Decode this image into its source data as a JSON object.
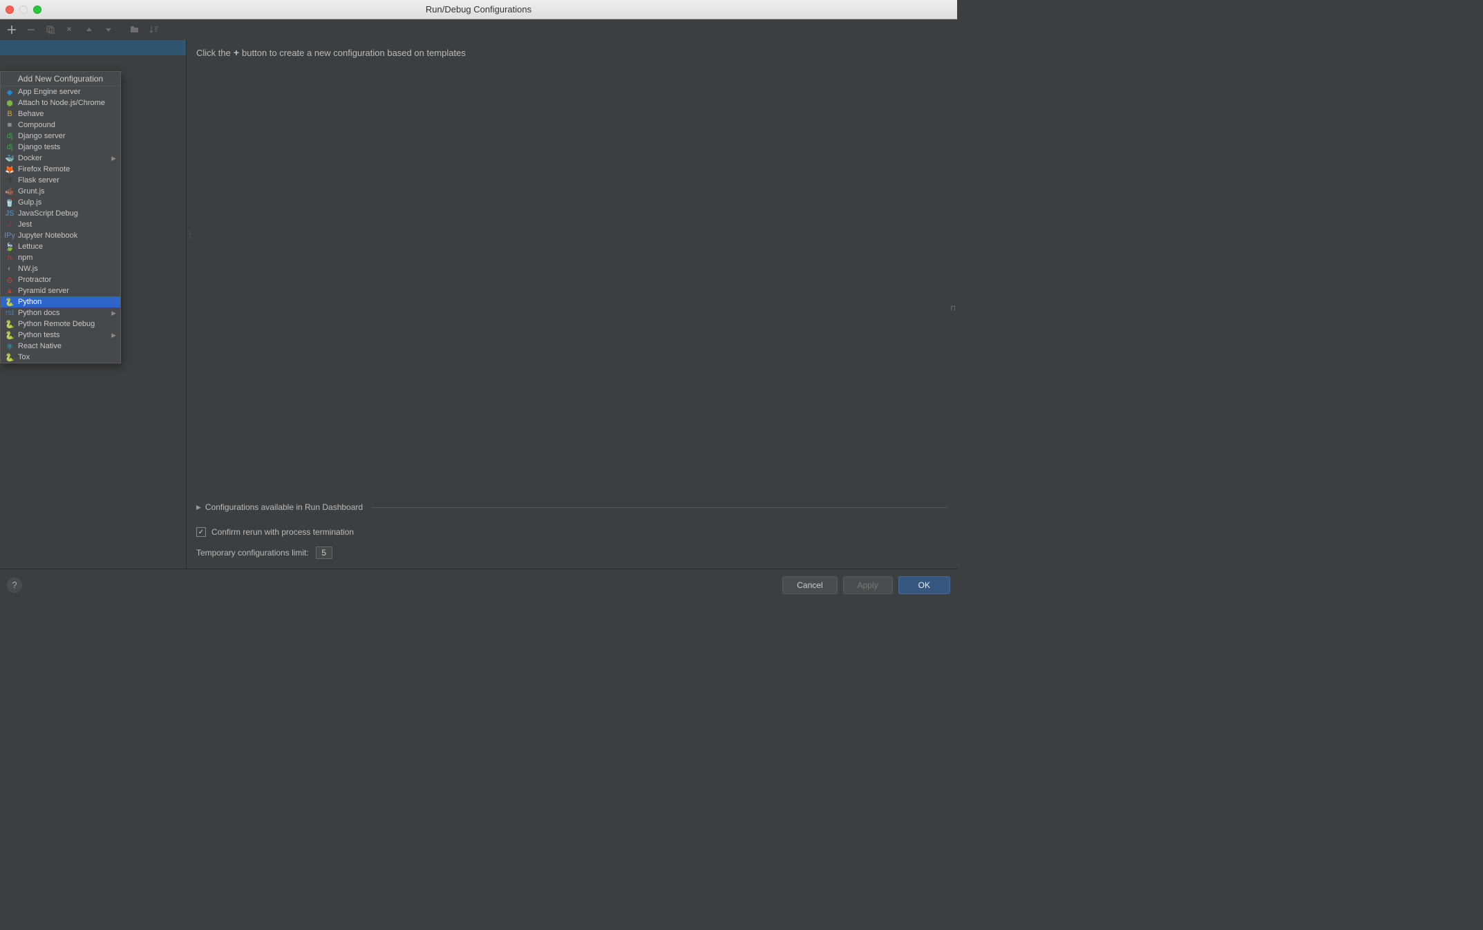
{
  "title": "Run/Debug Configurations",
  "dropdown": {
    "title": "Add New Configuration",
    "items": [
      {
        "label": "App Engine server",
        "icon": "◆",
        "color": "#1f8bd6"
      },
      {
        "label": "Attach to Node.js/Chrome",
        "icon": "⬢",
        "color": "#7cb342"
      },
      {
        "label": "Behave",
        "icon": "B",
        "color": "#d8a03c"
      },
      {
        "label": "Compound",
        "icon": "■",
        "color": "#8a8d8f"
      },
      {
        "label": "Django server",
        "icon": "dj",
        "color": "#43a047"
      },
      {
        "label": "Django tests",
        "icon": "dj",
        "color": "#43a047"
      },
      {
        "label": "Docker",
        "icon": "🐳",
        "color": "#2496ed",
        "submenu": true
      },
      {
        "label": "Firefox Remote",
        "icon": "🦊",
        "color": "#ff7139"
      },
      {
        "label": "Flask server",
        "icon": "⚗",
        "color": "#3a3a3a"
      },
      {
        "label": "Grunt.js",
        "icon": "🐗",
        "color": "#e48632"
      },
      {
        "label": "Gulp.js",
        "icon": "🥤",
        "color": "#cf4647"
      },
      {
        "label": "JavaScript Debug",
        "icon": "JS",
        "color": "#5097d5"
      },
      {
        "label": "Jest",
        "icon": "J",
        "color": "#c2185b"
      },
      {
        "label": "Jupyter Notebook",
        "icon": "IPy",
        "color": "#6a8caf"
      },
      {
        "label": "Lettuce",
        "icon": "🍃",
        "color": "#7cb342"
      },
      {
        "label": "npm",
        "icon": "n",
        "color": "#cb3837"
      },
      {
        "label": "NW.js",
        "icon": "◐",
        "color": "#7a7a7a"
      },
      {
        "label": "Protractor",
        "icon": "⊝",
        "color": "#d04334"
      },
      {
        "label": "Pyramid server",
        "icon": "▲",
        "color": "#c53a2c"
      },
      {
        "label": "Python",
        "icon": "🐍",
        "color": "#f2c94c",
        "selected": true
      },
      {
        "label": "Python docs",
        "icon": "rst",
        "color": "#4b7bab",
        "submenu": true
      },
      {
        "label": "Python Remote Debug",
        "icon": "🐍",
        "color": "#8a8d8f"
      },
      {
        "label": "Python tests",
        "icon": "🐍",
        "color": "#f2c94c",
        "submenu": true
      },
      {
        "label": "React Native",
        "icon": "⚛",
        "color": "#00d8ff"
      },
      {
        "label": "Tox",
        "icon": "🐍",
        "color": "#f2c94c"
      }
    ]
  },
  "hint": {
    "prefix": "Click the",
    "plus": "+",
    "suffix": "button to create a new configuration based on templates"
  },
  "dashboard_label": "Configurations available in Run Dashboard",
  "confirm_label": "Confirm rerun with process termination",
  "confirm_checked": true,
  "limit_label": "Temporary configurations limit:",
  "limit_value": "5",
  "buttons": {
    "cancel": "Cancel",
    "apply": "Apply",
    "ok": "OK"
  }
}
